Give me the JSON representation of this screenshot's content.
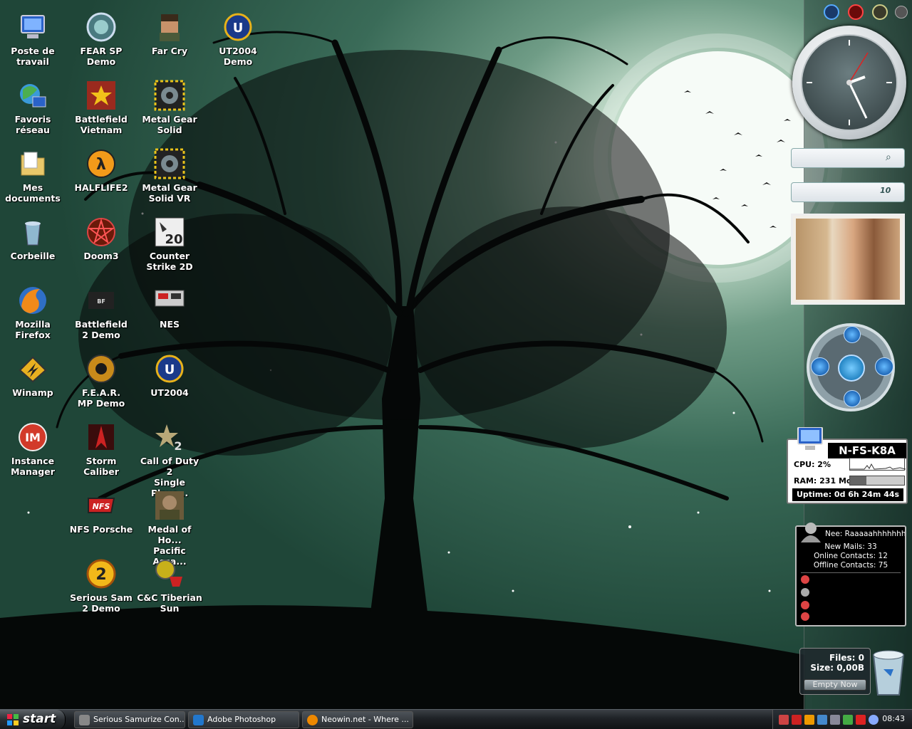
{
  "desktop": {
    "icons": [
      {
        "label": "Poste de\ntravail",
        "icon": "computer-icon"
      },
      {
        "label": "Favoris\nréseau",
        "icon": "network-icon"
      },
      {
        "label": "Mes\ndocuments",
        "icon": "folder-icon"
      },
      {
        "label": "Corbeille",
        "icon": "recycle-bin-icon"
      },
      {
        "label": "Mozilla\nFirefox",
        "icon": "firefox-icon"
      },
      {
        "label": "Winamp",
        "icon": "winamp-icon"
      },
      {
        "label": "Instance\nManager",
        "icon": "instance-manager-icon"
      },
      {
        "label": "FEAR SP\nDemo",
        "icon": "fear-icon"
      },
      {
        "label": "Battlefield\nVietnam",
        "icon": "battlefield-vietnam-icon"
      },
      {
        "label": "HALFLIFE2",
        "icon": "halflife-icon"
      },
      {
        "label": "Doom3",
        "icon": "doom3-icon"
      },
      {
        "label": "Battlefield\n2 Demo",
        "icon": "battlefield2-icon"
      },
      {
        "label": "F.E.A.R.\nMP Demo",
        "icon": "fear-mp-icon"
      },
      {
        "label": "Storm Caliber",
        "icon": "storm-caliber-icon"
      },
      {
        "label": "NFS Porsche",
        "icon": "nfs-icon"
      },
      {
        "label": "Serious Sam\n2 Demo",
        "icon": "serious-sam-icon"
      },
      {
        "label": "Far Cry",
        "icon": "far-cry-icon"
      },
      {
        "label": "Metal Gear\nSolid",
        "icon": "metal-gear-icon"
      },
      {
        "label": "Metal Gear\nSolid VR",
        "icon": "metal-gear-vr-icon"
      },
      {
        "label": "Counter\nStrike 2D",
        "icon": "counter-strike-icon"
      },
      {
        "label": "NES",
        "icon": "nes-icon"
      },
      {
        "label": "UT2004",
        "icon": "ut2004-icon"
      },
      {
        "label": "Call of Duty 2\nSingle Playe...",
        "icon": "call-of-duty-icon"
      },
      {
        "label": "Medal of Ho...\nPacific Assa...",
        "icon": "medal-of-honor-icon"
      },
      {
        "label": "C&C Tiberian\nSun",
        "icon": "cnc-icon"
      },
      {
        "label": "UT2004\nDemo",
        "icon": "ut2004-demo-icon"
      }
    ]
  },
  "sidebar": {
    "sysmon": {
      "host": "N-FS-K8A",
      "cpu": "CPU: 2%",
      "ram": "RAM: 231 Mo",
      "ram_fraction": 0.3,
      "uptime": "Uptime: 0d 6h 24m 44s"
    },
    "mail": {
      "status": "Nee:  Raaaaahhhhhhhh",
      "new_mails": "New Mails: 33",
      "online": "Online Contacts: 12",
      "offline": "Offline Contacts: 75"
    },
    "recycle": {
      "files": "Files: 0",
      "size": "Size: 0,00B",
      "empty_label": "Empty Now"
    }
  },
  "taskbar": {
    "start_label": "start",
    "tasks": [
      {
        "label": "Serious Samurize Con..."
      },
      {
        "label": "Adobe Photoshop"
      },
      {
        "label": "Neowin.net - Where ..."
      }
    ],
    "clock": "08:43"
  },
  "colors": {
    "accent": "#2a5a48",
    "moon": "#f6fbf7"
  }
}
